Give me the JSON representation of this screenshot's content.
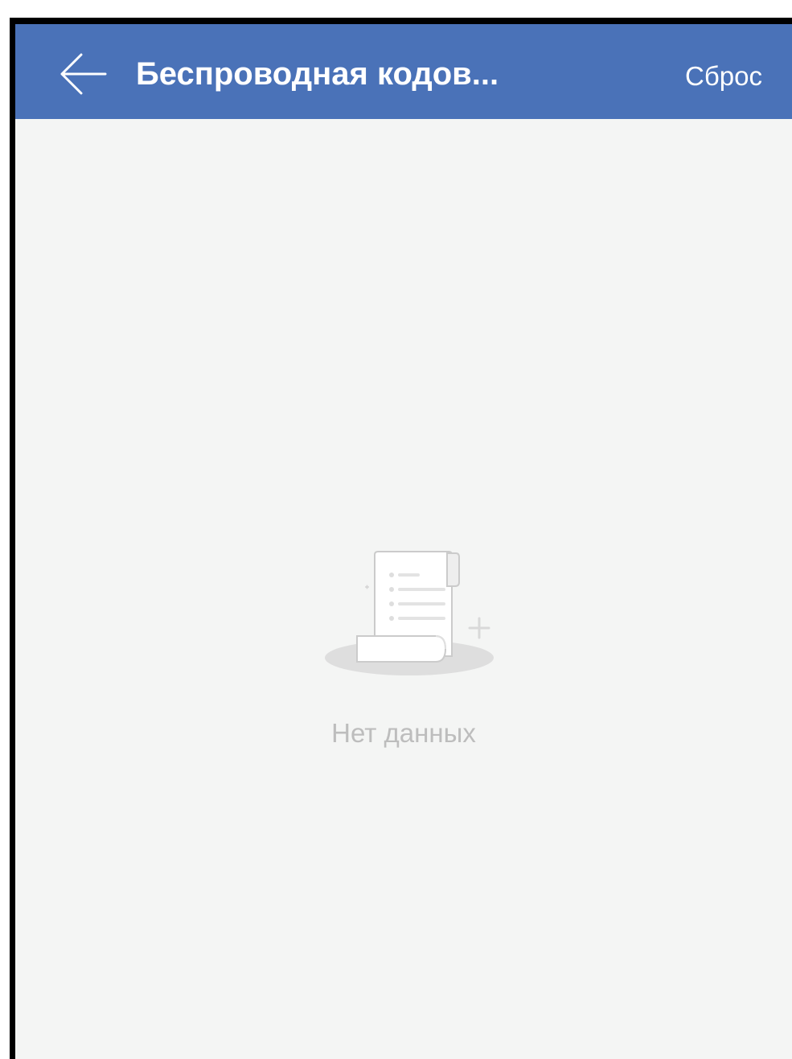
{
  "header": {
    "title": "Беспроводная кодов...",
    "back_icon": "arrow-left-icon",
    "reset_label": "Сброс",
    "background_color": "#4a72b8",
    "text_color": "#ffffff"
  },
  "empty_state": {
    "icon": "document-scroll-icon",
    "message": "Нет данных",
    "text_color": "#bdbdbd"
  },
  "colors": {
    "screen_background": "#f4f5f4"
  }
}
